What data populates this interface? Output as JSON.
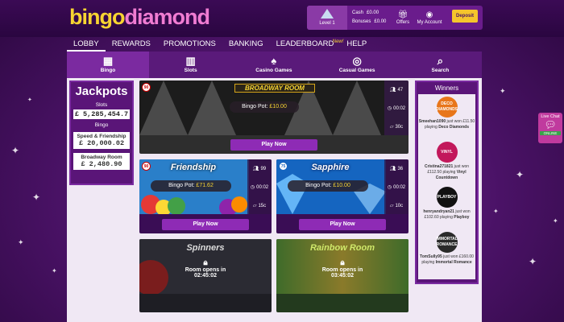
{
  "brand": {
    "part1": "bingo",
    "part2": "diamond"
  },
  "account": {
    "level_label": "Level 1",
    "cash_label": "Cash",
    "cash_value": "£0.00",
    "bonuses_label": "Bonuses",
    "bonuses_value": "£0.00",
    "offers_label": "Offers",
    "my_account_label": "My Account",
    "deposit_label": "Deposit"
  },
  "nav": {
    "items": [
      "LOBBY",
      "REWARDS",
      "PROMOTIONS",
      "BANKING",
      "LEADERBOARD",
      "HELP"
    ],
    "new_badge": "New!"
  },
  "categories": [
    "Bingo",
    "Slots",
    "Casino Games",
    "Casual Games",
    "Search"
  ],
  "jackpots": {
    "title": "Jackpots",
    "slots_label": "Slots",
    "slots_value": "£ 5,285,454.7",
    "bingo_label": "Bingo",
    "speed_label": "Speed & Friendship",
    "speed_value": "£ 20,000.02",
    "broadway_label": "Broadway Room",
    "broadway_value": "£ 2,480.90"
  },
  "rooms": {
    "broadway": {
      "title": "BROADWAY ROOM",
      "pot_label": "Bingo Pot:",
      "pot_value": "£10.00",
      "players": "47",
      "time": "00:02",
      "price": "30c",
      "play": "Play Now",
      "badge": "90"
    },
    "friendship": {
      "title": "Friendship",
      "pot_label": "Bingo Pot:",
      "pot_value": "£71.62",
      "players": "99",
      "time": "00:02",
      "price": "15c",
      "play": "Play Now",
      "badge": "90"
    },
    "sapphire": {
      "title": "Sapphire",
      "pot_label": "Bingo Pot:",
      "pot_value": "£10.00",
      "players": "36",
      "time": "00:02",
      "price": "10c",
      "play": "Play Now",
      "badge": "75"
    },
    "spinners": {
      "title": "Spinners",
      "opens_label": "Room opens in",
      "opens_time": "02:45:02"
    },
    "rainbow": {
      "title": "Rainbow Room",
      "opens_label": "Room opens in",
      "opens_time": "03:45:02"
    }
  },
  "winners": {
    "title": "Winners",
    "list": [
      {
        "name": "Smeehan1090",
        "won": "just won",
        "amount": "£11.50",
        "playing": "playing",
        "game": "Deco Diamonds",
        "logo": "DECO DIAMONDS",
        "color": "#e8761a"
      },
      {
        "name": "Cristina271821",
        "won": "just won",
        "amount": "£112.50",
        "playing": "playing",
        "game": "Vinyl Countdown",
        "logo": "VINYL",
        "color": "#c2185b"
      },
      {
        "name": "henryandryan21",
        "won": "just won",
        "amount": "£102.60",
        "playing": "playing",
        "game": "Playboy",
        "logo": "PLAYBOY",
        "color": "#111111"
      },
      {
        "name": "TomSully95",
        "won": "just won",
        "amount": "£160.00",
        "playing": "playing",
        "game": "Immortal Romance",
        "logo": "IMMORTAL ROMANCE",
        "color": "#2a2a2a"
      }
    ]
  },
  "live_chat": {
    "label": "Live Chat",
    "status": "ONLINE"
  }
}
